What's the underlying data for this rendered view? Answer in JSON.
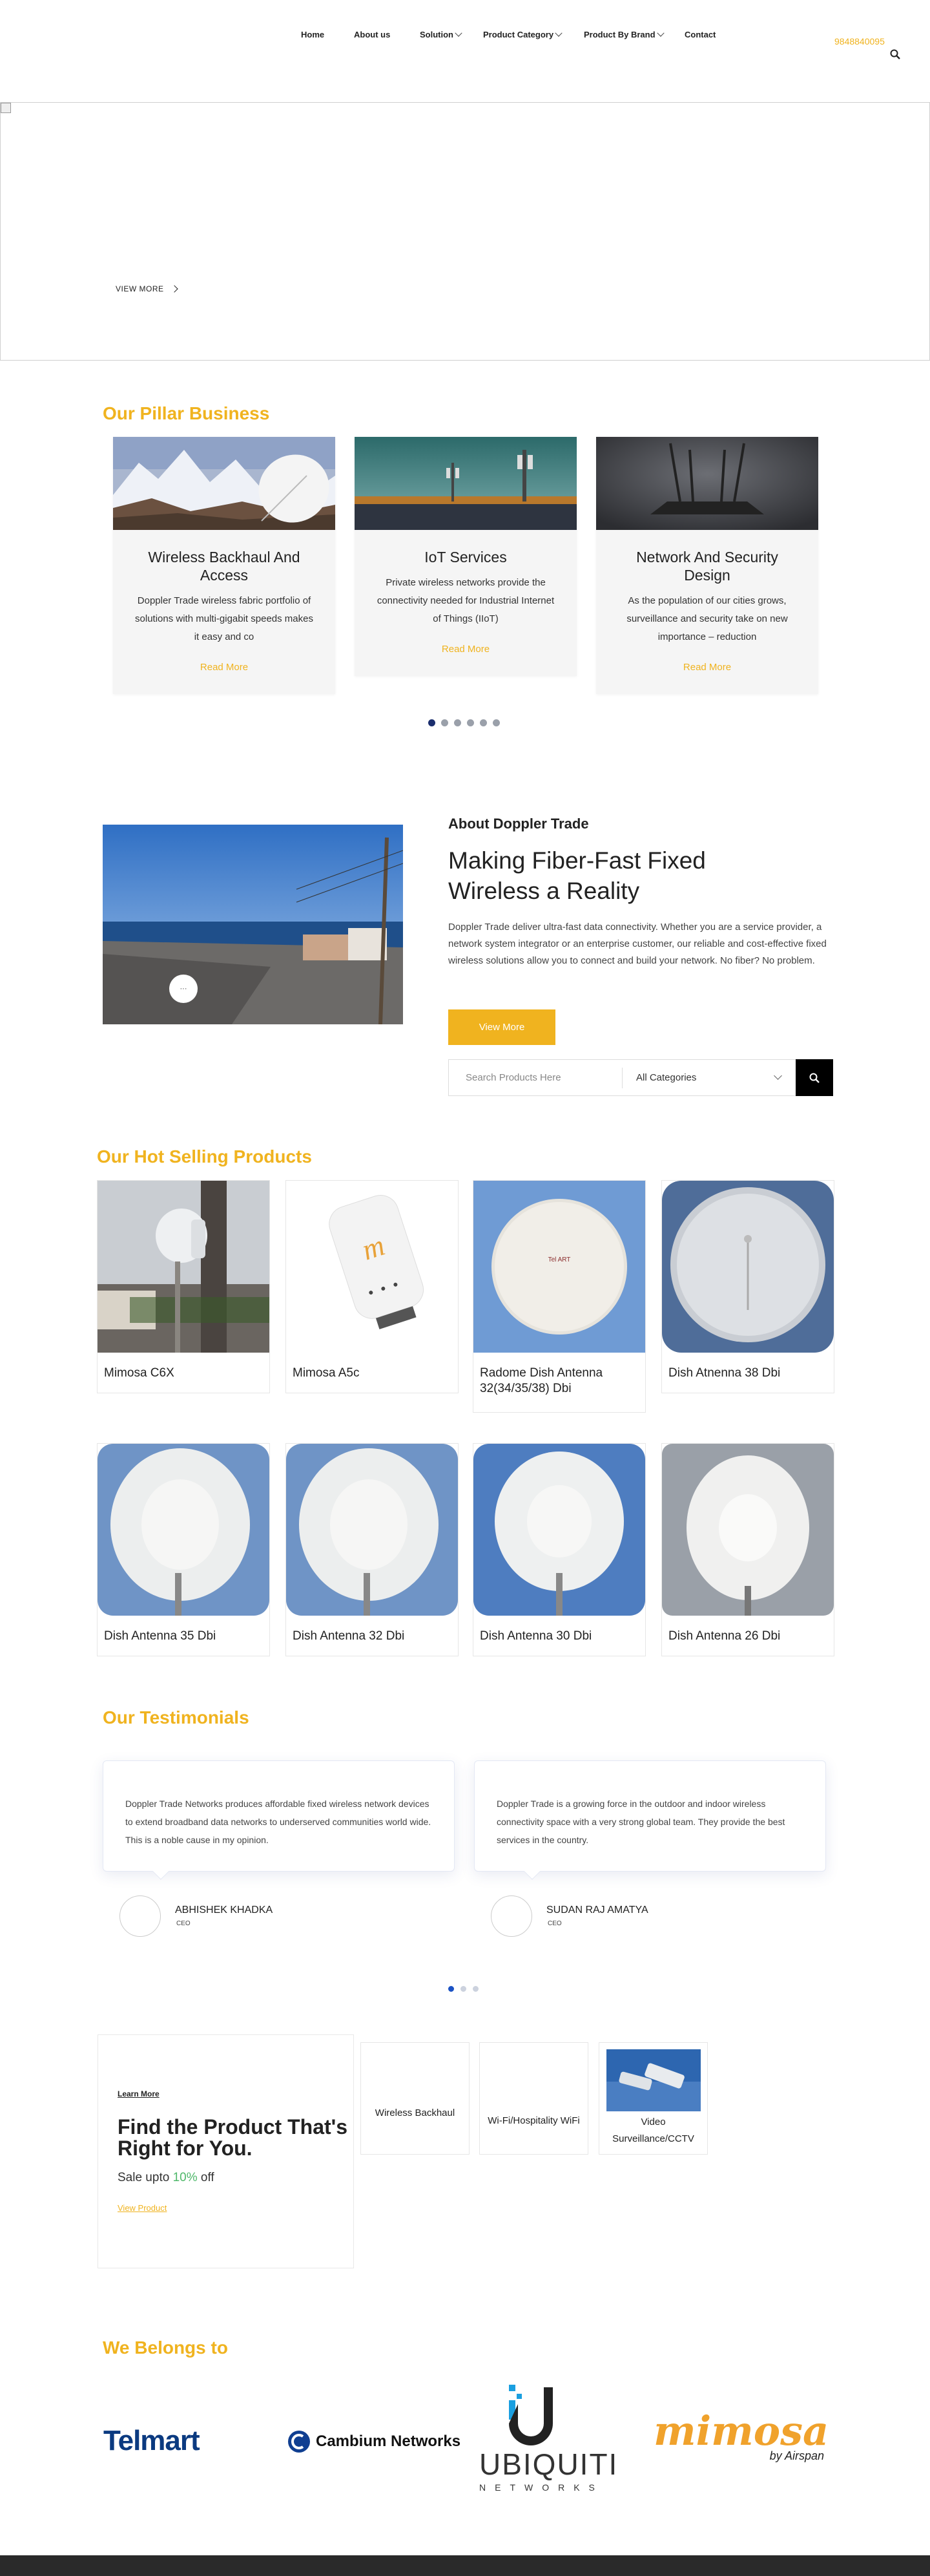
{
  "nav": {
    "items": [
      "Home",
      "About us",
      "Solution",
      "Product Category",
      "Product By Brand",
      "Contact"
    ],
    "phone": "9848840095"
  },
  "hero": {
    "view_more": "VIEW MORE"
  },
  "pillar": {
    "title": "Our Pillar Business",
    "cards": [
      {
        "title": "Wireless Backhaul And Access",
        "text": "Doppler Trade wireless fabric portfolio of solutions with multi-gigabit speeds makes it easy and co",
        "link": "Read More"
      },
      {
        "title": "IoT Services",
        "text": "Private wireless networks provide the connectivity needed for Industrial Internet of Things (IIoT)",
        "link": "Read More"
      },
      {
        "title": "Network And Security Design",
        "text": "As the population of our cities grows, surveillance and security take on new importance – reduction",
        "link": "Read More"
      }
    ]
  },
  "about": {
    "label": "About Doppler Trade",
    "heading": "Making Fiber-Fast Fixed Wireless a Reality",
    "text": "Doppler Trade deliver ultra-fast data connectivity. Whether you are a service provider, a network system integrator or an enterprise customer, our reliable and cost-effective fixed wireless solutions allow you to connect and build your network. No fiber? No problem.",
    "button": "View More",
    "play": "···",
    "search_placeholder": "Search Products Here",
    "category": "All Categories"
  },
  "products": {
    "title": "Our Hot Selling Products",
    "items": [
      "Mimosa C6X",
      "Mimosa A5c",
      "Radome Dish Antenna 32(34/35/38) Dbi",
      "Dish Atnenna 38 Dbi",
      "Dish Antenna 35 Dbi",
      "Dish Antenna 32 Dbi",
      "Dish Antenna 30 Dbi",
      "Dish Antenna 26 Dbi"
    ]
  },
  "testimonials": {
    "title": "Our Testimonials",
    "items": [
      {
        "text": "Doppler Trade Networks produces affordable fixed wireless network devices to extend broadband data networks to underserved communities world wide. This is a noble cause in my opinion.",
        "name": "ABHISHEK KHADKA",
        "role": "CEO"
      },
      {
        "text": "Doppler Trade is a growing force in the outdoor and indoor wireless connectivity space with a very strong global team. They provide the best services in the country.",
        "name": "SUDAN RAJ AMATYA",
        "role": "CEO"
      }
    ]
  },
  "find": {
    "learn_more": "Learn More",
    "heading": "Find the Product That's Right for You.",
    "sale_prefix": "Sale upto ",
    "sale_pct": "10%",
    "sale_suffix": " off",
    "view_product": "View Product",
    "categories": [
      "Wireless Backhaul",
      "Wi-Fi/Hospitality WiFi",
      "Video Surveillance/CCTV"
    ]
  },
  "belongs": {
    "title": "We Belongs to",
    "logos": {
      "telmart": "Telmart",
      "cambium": "Cambium Networks",
      "ubiquiti": "UBIQUITI",
      "ubiquiti_sub": "NETWORKS",
      "mimosa": "mimosa",
      "mimosa_sub": "by Airspan"
    }
  },
  "colors": {
    "accent": "#f0b31f",
    "dark": "#222222",
    "navy": "#1b2e6e"
  }
}
